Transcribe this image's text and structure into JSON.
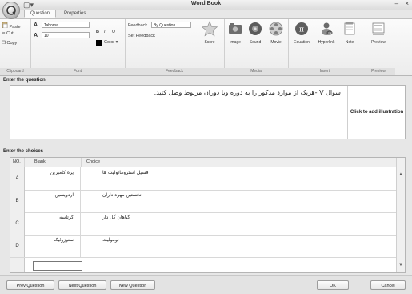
{
  "window": {
    "title": "Word Book",
    "quick_access_glyph": "▢▾"
  },
  "tabs": [
    {
      "label": "Question",
      "active": true
    },
    {
      "label": "Properties",
      "active": false
    }
  ],
  "ribbon": {
    "clipboard": {
      "paste": "Paste",
      "cut": "Cut",
      "copy": "Copy",
      "group_label": "Clipboard"
    },
    "font": {
      "font_name": "Tahoma",
      "font_size": "10",
      "bold": "B",
      "italic": "I",
      "underline": "U",
      "color_label": "Color",
      "group_label": "Font"
    },
    "feedback": {
      "feedback_label": "Feedback",
      "feedback_value": "By Question",
      "set_feedback": "Set Feedback",
      "score": "Score",
      "group_label": "Feedback"
    },
    "media": {
      "image": "Image",
      "sound": "Sound",
      "movie": "Movie",
      "group_label": "Media"
    },
    "insert": {
      "equation": "Equation",
      "hyperlink": "Hyperlink",
      "note": "Note",
      "group_label": "Insert"
    },
    "preview": {
      "preview": "Preview",
      "group_label": "Preview"
    }
  },
  "question": {
    "section_label": "Enter the question",
    "text": "سوال V -هريک از موارد مذکور را به دوره ويا دوران مربوط وصل کنيد.",
    "illustration_hint": "Click to add illustration"
  },
  "choices": {
    "section_label": "Enter the choices",
    "headers": {
      "no": "NO.",
      "blank": "Blank",
      "choice": "Choice"
    },
    "rows": [
      {
        "no": "A",
        "blank": "پره کامبرين",
        "choice": "فسيل استروماتوليت ها"
      },
      {
        "no": "B",
        "blank": "اردويسين",
        "choice": "نخستين مهره داران"
      },
      {
        "no": "C",
        "blank": "کرتاسه",
        "choice": "گياهان گل دار"
      },
      {
        "no": "D",
        "blank": "سنوزوئيک",
        "choice": "نوموليت"
      }
    ]
  },
  "footer": {
    "prev": "Prev Question",
    "next": "Next Question",
    "new": "New Question",
    "ok": "OK",
    "cancel": "Cancel"
  },
  "colors": {
    "accent": "#2f5d9a",
    "score_star": "#c8c8c8"
  }
}
